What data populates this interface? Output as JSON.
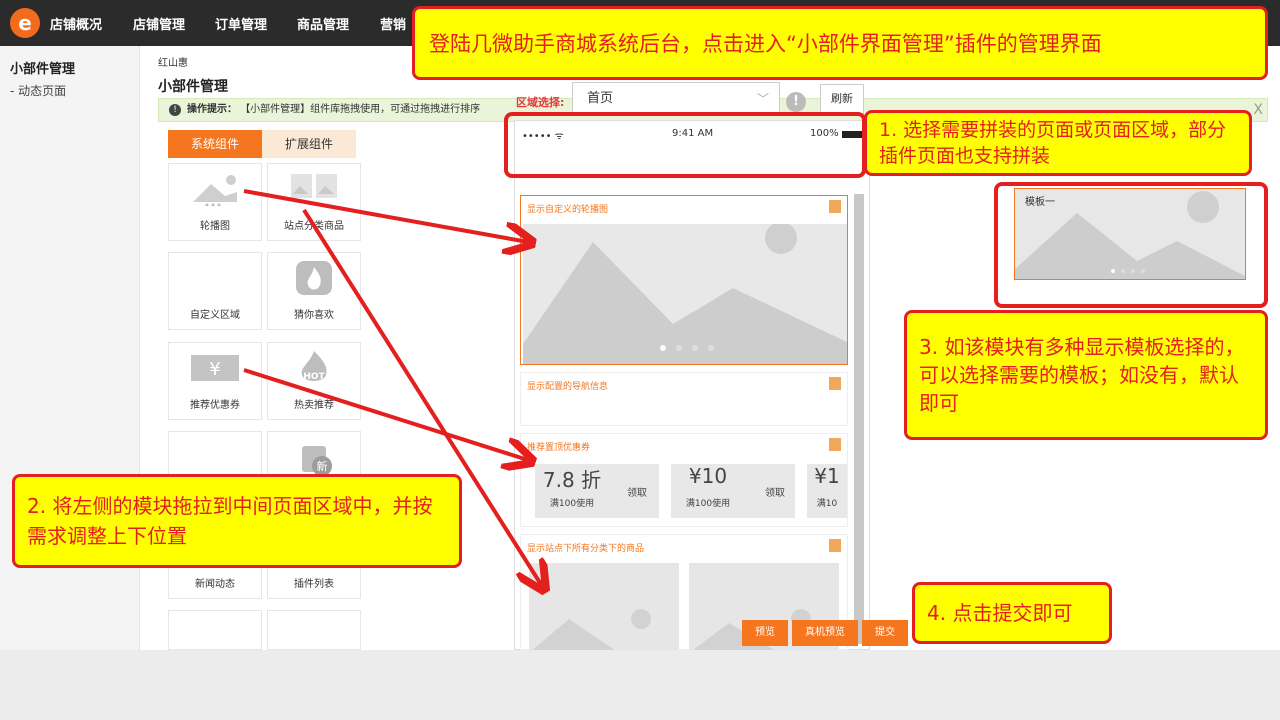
{
  "nav": {
    "logo_glyph": "e",
    "items": [
      "店铺概况",
      "店铺管理",
      "订单管理",
      "商品管理",
      "营销"
    ]
  },
  "sidebar": {
    "title": "小部件管理",
    "sub_item": "- 动态页面"
  },
  "breadcrumb": "红山惠",
  "page_title": "小部件管理",
  "tip": {
    "label": "操作提示：",
    "text": "【小部件管理】组件库拖拽使用，可通过拖拽进行排序",
    "close": "X"
  },
  "tabs": {
    "system": "系统组件",
    "extended": "扩展组件"
  },
  "widgets": [
    {
      "label": "轮播图",
      "icon": "carousel-icon"
    },
    {
      "label": "站点分类商品",
      "icon": "category-goods-icon"
    },
    {
      "label": "自定义区域",
      "icon": ""
    },
    {
      "label": "猜你喜欢",
      "icon": "fire-icon"
    },
    {
      "label": "推荐优惠券",
      "icon": "coupon-yen-icon"
    },
    {
      "label": "热卖推荐",
      "icon": "hot-icon"
    },
    {
      "label": "",
      "icon": ""
    },
    {
      "label": "",
      "icon": "new-bag-icon"
    },
    {
      "label": "新闻动态",
      "icon": ""
    },
    {
      "label": "插件列表",
      "icon": ""
    },
    {
      "label": "",
      "icon": ""
    },
    {
      "label": "",
      "icon": ""
    }
  ],
  "region": {
    "label": "区域选择:",
    "selected": "首页",
    "refresh": "刷新"
  },
  "phone": {
    "signal": "••••• ᯤ",
    "time": "9:41 AM",
    "battery": "100%"
  },
  "modules": {
    "carousel_title": "显示自定义的轮播图",
    "nav_title": "显示配置的导航信息",
    "coupon_title": "推荐置顶优惠券",
    "goods_title": "显示站点下所有分类下的商品"
  },
  "coupons": [
    {
      "amount": "7.8 折",
      "condition": "满100使用",
      "action": "领取"
    },
    {
      "amount": "¥10",
      "condition": "满100使用",
      "action": "领取"
    },
    {
      "amount": "¥1",
      "condition": "满10",
      "action": ""
    }
  ],
  "template": {
    "label": "模板一"
  },
  "buttons": {
    "preview": "预览",
    "device_preview": "真机预览",
    "submit": "提交"
  },
  "notes": {
    "top": "登陆几微助手商城系统后台，点击进入“小部件界面管理”插件的管理界面",
    "step1": "1. 选择需要拼装的页面或页面区域，部分插件页面也支持拼装",
    "step2": "2. 将左侧的模块拖拉到中间页面区域中，并按需求调整上下位置",
    "step3": "3. 如该模块有多种显示模板选择的，可以选择需要的模板；如没有，默认即可",
    "step4": "4. 点击提交即可"
  },
  "colors": {
    "accent": "#f5761e",
    "annotation_red": "#e4201f",
    "annotation_yellow": "#ffff00",
    "nav_bg": "#2b2b2b"
  }
}
